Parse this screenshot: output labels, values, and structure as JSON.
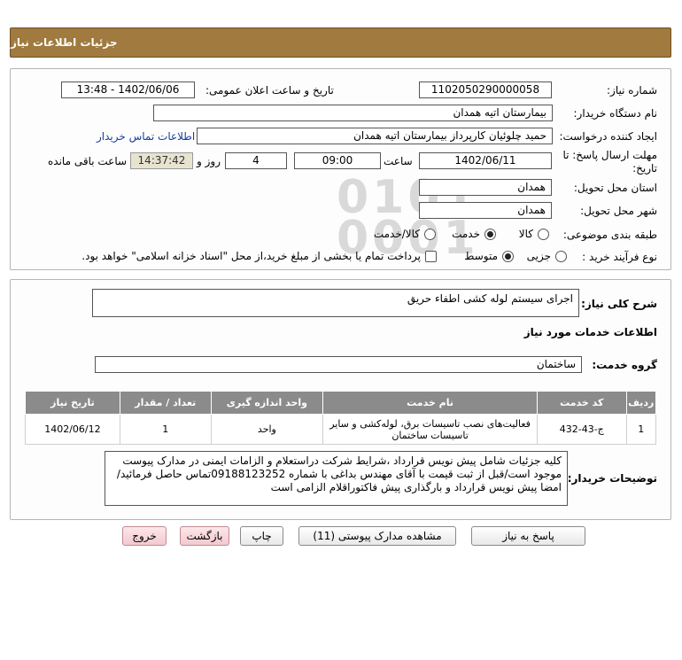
{
  "header": {
    "title": "جزئیات اطلاعات نیاز"
  },
  "form": {
    "need_number_label": "شماره نیاز:",
    "need_number": "1102050290000058",
    "announce_label": "تاریخ و ساعت اعلان عمومی:",
    "announce_value": "1402/06/06 - 13:48",
    "buyer_org_label": "نام دستگاه خریدار:",
    "buyer_org": "بیمارستان اتیه همدان",
    "creator_label": "ایجاد کننده درخواست:",
    "creator": "حمید چلوئیان  کارپرداز بیمارستان اتیه همدان",
    "contact_link": "اطلاعات تماس خریدار",
    "deadline_label_line1": "مهلت ارسال پاسخ: تا",
    "deadline_label_line2": "تاریخ:",
    "deadline_date": "1402/06/11",
    "time_label": "ساعت",
    "deadline_time": "09:00",
    "days_value": "4",
    "days_label": "روز و",
    "remaining_time": "14:37:42",
    "remaining_label": "ساعت باقی مانده",
    "province_label": "استان محل تحویل:",
    "province": "همدان",
    "city_label": "شهر محل تحویل:",
    "city": "همدان",
    "category_label": "طبقه بندی موضوعی:",
    "category_options": [
      "کالا",
      "خدمت",
      "کالا/خدمت"
    ],
    "category_selected": "خدمت",
    "process_label": "نوع فرآیند خرید :",
    "process_options": [
      "جزیی",
      "متوسط"
    ],
    "process_selected": "متوسط",
    "treasury_note": "پرداخت تمام یا بخشی از مبلغ خرید،از محل \"اسناد خزانه اسلامی\" خواهد بود."
  },
  "details": {
    "summary_label": "شرح کلی نیاز:",
    "summary": "اجرای سیستم لوله کشی اطفاء حریق",
    "services_heading": "اطلاعات خدمات مورد نیاز",
    "service_group_label": "گروه خدمت:",
    "service_group": "ساختمان",
    "table": {
      "headers": [
        "ردیف",
        "کد خدمت",
        "نام خدمت",
        "واحد اندازه گیری",
        "تعداد / مقدار",
        "تاریخ نیاز"
      ],
      "rows": [
        [
          "1",
          "ج-43-432",
          "فعالیت‌های نصب تاسیسات برق، لوله‌کشی و سایر تاسیسات ساختمان",
          "واحد",
          "1",
          "1402/06/12"
        ]
      ]
    },
    "buyer_notes_label": "توضیحات خریدار:",
    "buyer_notes": "کلیه جزئیات شامل پیش نویس قرارداد ،شرایط شرکت دراستعلام و الزامات ایمنی در مدارک پیوست موجود است/قبل از ثبت قیمت با آقای مهندس بداغی با شماره 09188123252تماس حاصل فرمائید/امضا پیش نویس قرارداد و بارگذاری پیش فاکتوراقلام الزامی است"
  },
  "buttons": {
    "reply": "پاسخ به نیاز",
    "attachments": "مشاهده مدارک پیوستی (11)",
    "print": "چاپ",
    "back": "بازگشت",
    "exit": "خروج"
  }
}
